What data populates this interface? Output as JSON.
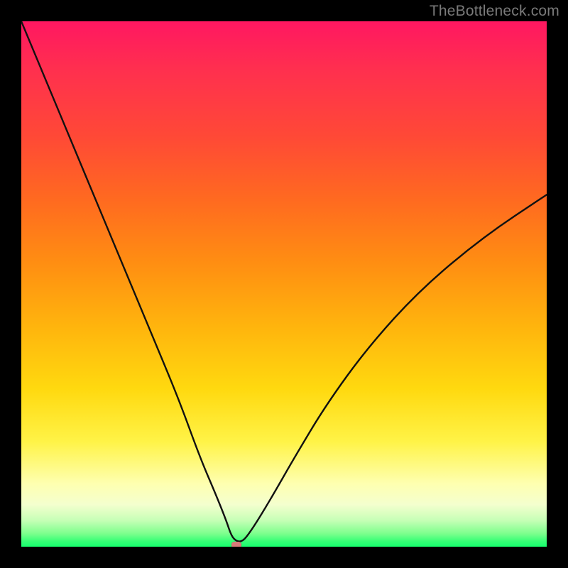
{
  "watermark": "TheBottleneck.com",
  "chart_data": {
    "type": "line",
    "title": "",
    "xlabel": "",
    "ylabel": "",
    "xlim": [
      0,
      100
    ],
    "ylim": [
      0,
      100
    ],
    "grid": false,
    "legend": false,
    "background_gradient": {
      "direction": "vertical",
      "stops": [
        {
          "pos": 0.0,
          "color": "#ff1761"
        },
        {
          "pos": 0.22,
          "color": "#ff4936"
        },
        {
          "pos": 0.46,
          "color": "#ff8e12"
        },
        {
          "pos": 0.7,
          "color": "#ffd90f"
        },
        {
          "pos": 0.88,
          "color": "#feffb0"
        },
        {
          "pos": 0.95,
          "color": "#c6ffb6"
        },
        {
          "pos": 1.0,
          "color": "#17ff6e"
        }
      ]
    },
    "series": [
      {
        "name": "bottleneck-curve",
        "color": "#111111",
        "x": [
          0,
          5,
          10,
          15,
          20,
          25,
          30,
          34,
          37,
          39,
          40,
          41,
          42,
          43,
          45,
          48,
          52,
          58,
          66,
          76,
          88,
          100
        ],
        "y": [
          100,
          88,
          76,
          64,
          52,
          40,
          28,
          17,
          10,
          5,
          2,
          1,
          1,
          2,
          5,
          10,
          17,
          27,
          38,
          49,
          59,
          67
        ]
      }
    ],
    "marker": {
      "x": 41,
      "y": 0,
      "color": "#d87a79"
    }
  }
}
